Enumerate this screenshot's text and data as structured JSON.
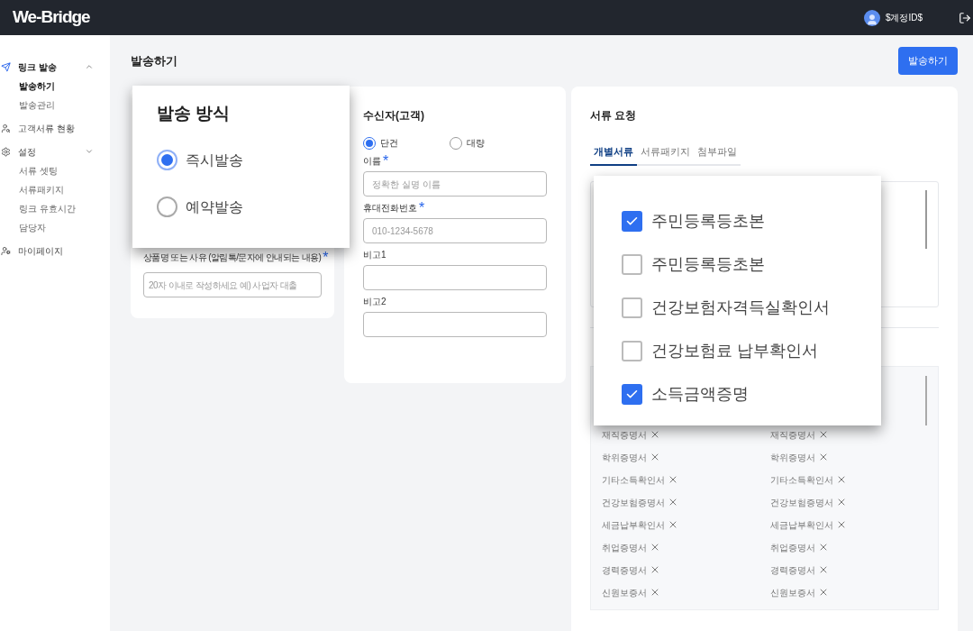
{
  "header": {
    "logo": "We-Bridge",
    "user_id": "$계정ID$"
  },
  "sidebar": {
    "groups": [
      {
        "kind": "link_send",
        "label": "링크 발송",
        "expanded": true,
        "children": [
          {
            "label": "발송하기",
            "selected": true
          },
          {
            "label": "발송관리",
            "selected": false
          }
        ]
      },
      {
        "kind": "customer_docs",
        "label": "고객서류 현황"
      },
      {
        "kind": "settings",
        "label": "설정",
        "expanded": false,
        "children": [
          {
            "label": "서류 셋팅",
            "selected": false
          },
          {
            "label": "서류패키지",
            "selected": false
          },
          {
            "label": "링크 유효시간",
            "selected": false
          },
          {
            "label": "담당자",
            "selected": false
          }
        ]
      },
      {
        "kind": "mypage",
        "label": "마이페이지"
      }
    ]
  },
  "page": {
    "title": "발송하기",
    "send_button": "발송하기"
  },
  "send_method": {
    "title": "발송 방식",
    "options": [
      {
        "label": "즉시발송",
        "selected": true
      },
      {
        "label": "예약발송",
        "selected": false
      }
    ]
  },
  "product": {
    "label": "상품명 또는 사유 (알림톡/문자에 안내되는 내용)",
    "required_mark": "*",
    "placeholder": "20자 이내로 작성하세요 예) 사업자 대출"
  },
  "recipient": {
    "title": "수신자(고객)",
    "modes": [
      {
        "label": "단건",
        "selected": true
      },
      {
        "label": "대량",
        "selected": false
      }
    ],
    "fields": [
      {
        "label": "이름",
        "required_mark": "*",
        "placeholder": "정확한 실명 이름"
      },
      {
        "label": "휴대전화번호",
        "required_mark": "*",
        "placeholder": "010-1234-5678"
      },
      {
        "label": "비고1"
      },
      {
        "label": "비고2"
      }
    ]
  },
  "documents": {
    "title": "서류 요청",
    "tabs": [
      {
        "label": "개별서류",
        "selected": true
      },
      {
        "label": "서류패키지",
        "selected": false
      },
      {
        "label": "첨부파일",
        "selected": false
      }
    ],
    "checklist": [
      {
        "label": "주민등록등초본",
        "checked": true
      },
      {
        "label": "주민등록등초본",
        "checked": false
      },
      {
        "label": "건강보험자격득실확인서",
        "checked": false
      },
      {
        "label": "건강보험료 납부확인서",
        "checked": false
      },
      {
        "label": "소득금액증명",
        "checked": true
      }
    ],
    "selected_columns": [
      [
        "재직증명서",
        "학위증명서",
        "기타소득확인서",
        "건강보험증명서",
        "세금납부확인서",
        "취업증명서",
        "경력증명서",
        "신원보증서"
      ],
      [
        "재직증명서",
        "학위증명서",
        "기타소득확인서",
        "건강보험증명서",
        "세금납부확인서",
        "취업증명서",
        "경력증명서",
        "신원보증서"
      ]
    ]
  }
}
